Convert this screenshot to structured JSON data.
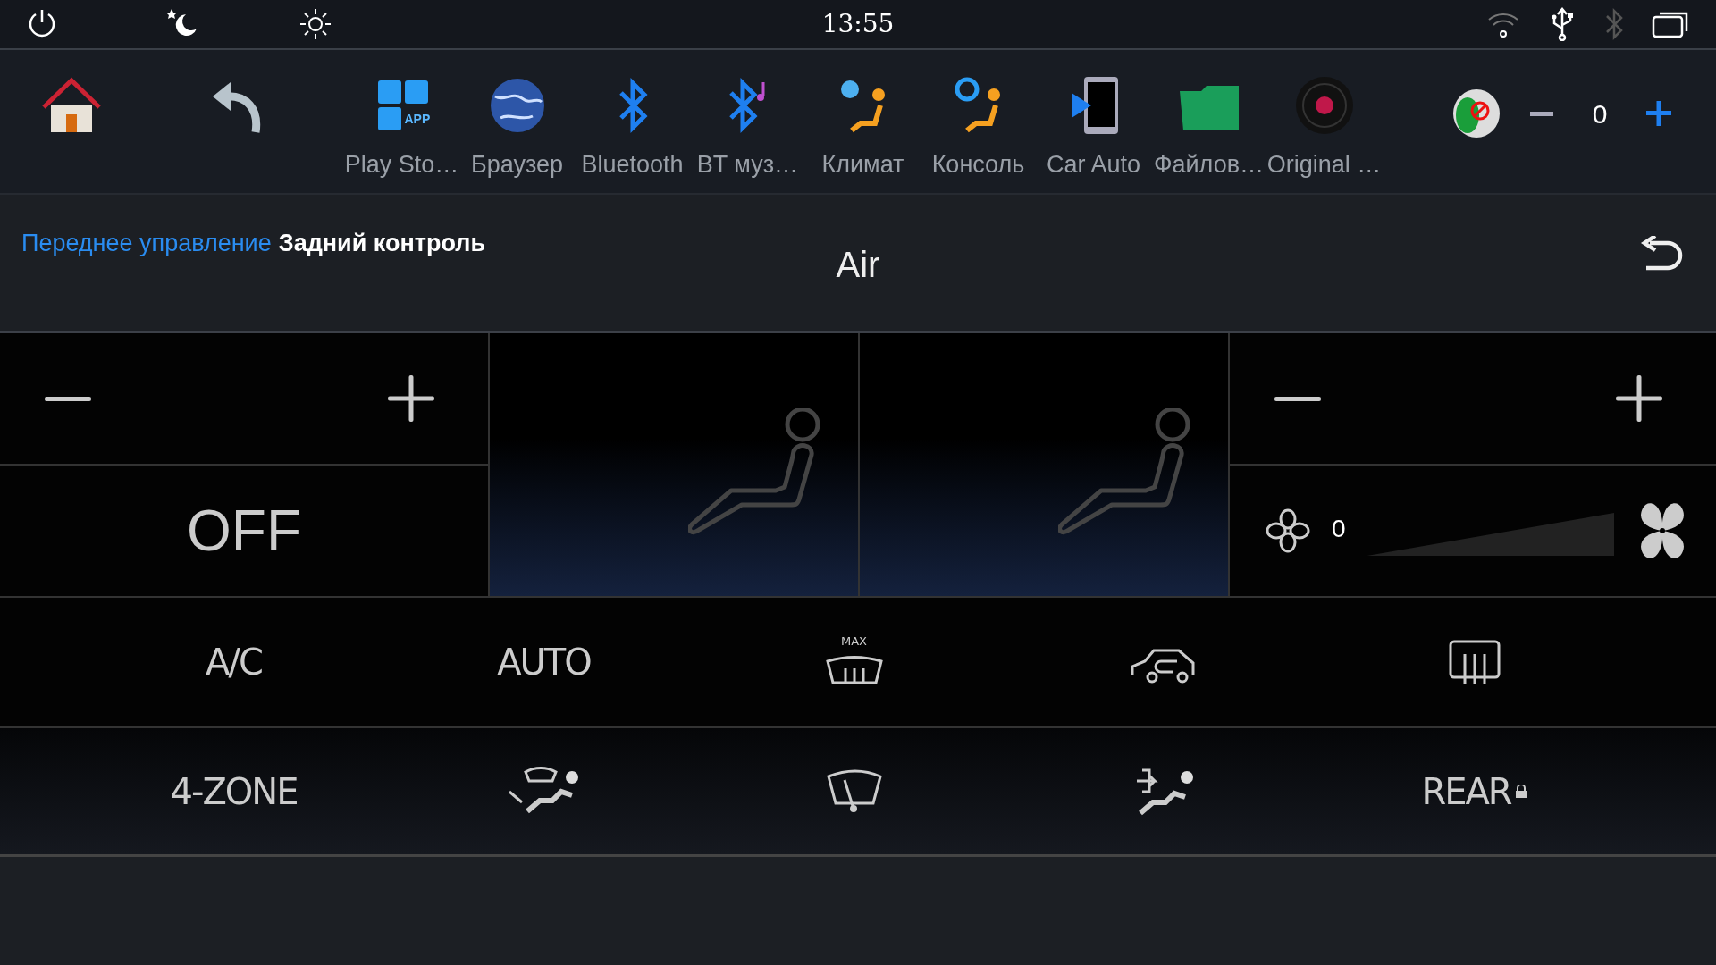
{
  "status_bar": {
    "time": "13:55"
  },
  "apps": [
    {
      "label": "Play Sto…",
      "icon_text": "APP"
    },
    {
      "label": "Браузер"
    },
    {
      "label": "Bluetooth"
    },
    {
      "label": "BT муз…"
    },
    {
      "label": "Климат"
    },
    {
      "label": "Консоль"
    },
    {
      "label": "Car Auto"
    },
    {
      "label": "Файлов…"
    },
    {
      "label": "Original …"
    }
  ],
  "volume": {
    "value": "0"
  },
  "tabs": [
    {
      "label": "Переднее управление",
      "selected": true
    },
    {
      "label": "Задний контроль",
      "selected": false
    }
  ],
  "title": "Air",
  "left_zone": {
    "temperature": "OFF"
  },
  "fan": {
    "value": "0",
    "level": 0
  },
  "buttons": [
    {
      "kind": "text",
      "label": "A/C"
    },
    {
      "kind": "text",
      "label": "AUTO"
    },
    {
      "kind": "icon",
      "caption": "MAX"
    },
    {
      "kind": "icon"
    },
    {
      "kind": "icon"
    },
    {
      "kind": "text",
      "label": "4-ZONE"
    },
    {
      "kind": "icon"
    },
    {
      "kind": "icon"
    },
    {
      "kind": "icon"
    },
    {
      "kind": "text",
      "label": "REAR"
    }
  ]
}
